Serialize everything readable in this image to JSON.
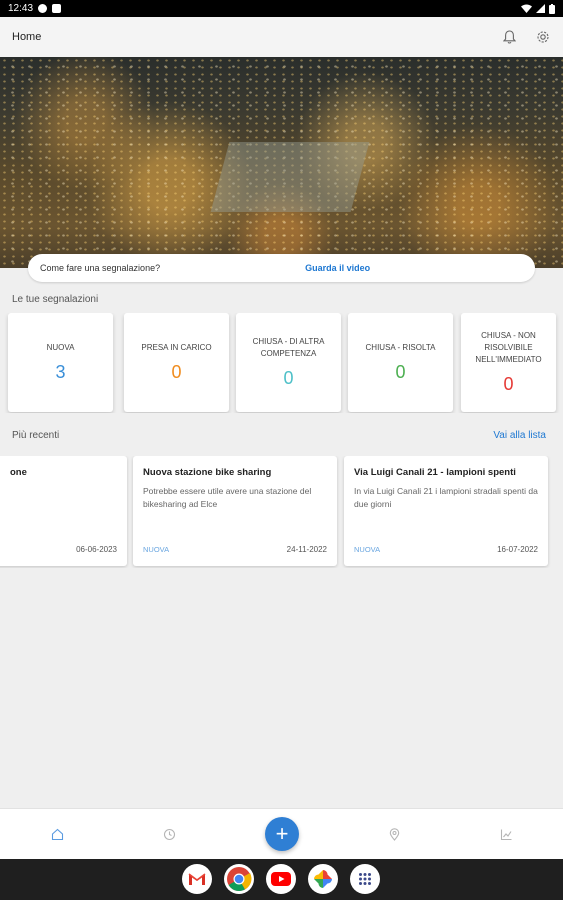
{
  "status_bar": {
    "time": "12:43"
  },
  "app_bar": {
    "title": "Home",
    "icons": [
      "bell-icon",
      "gear-icon"
    ]
  },
  "hero": {
    "image": "aerial-city-night-photo"
  },
  "video_prompt": {
    "question": "Come fare una segnalazione?",
    "link": "Guarda il video"
  },
  "stats_section": {
    "label": "Le tue segnalazioni",
    "items": [
      {
        "label": "NUOVA",
        "value": "3",
        "color": "#3a8fd8"
      },
      {
        "label": "PRESA IN CARICO",
        "value": "0",
        "color": "#f08c1e"
      },
      {
        "label": "CHIUSA - DI ALTRA COMPETENZA",
        "value": "0",
        "color": "#4ec0c8"
      },
      {
        "label": "CHIUSA - RISOLTA",
        "value": "0",
        "color": "#4caf50"
      },
      {
        "label": "CHIUSA - NON RISOLVIBILE NELL'IMMEDIATO",
        "value": "0",
        "color": "#e53935"
      }
    ]
  },
  "recent_section": {
    "label": "Più recenti",
    "link": "Vai alla lista",
    "cards": [
      {
        "title": "one",
        "description": "",
        "status": "",
        "date": "06-06-2023"
      },
      {
        "title": "Nuova stazione bike sharing",
        "description": "Potrebbe essere utile avere una stazione del bikesharing ad Elce",
        "status": "NUOVA",
        "date": "24-11-2022"
      },
      {
        "title": "Via Luigi Canali 21 - lampioni spenti",
        "description": "In via Luigi Canali 21 i lampioni stradali spenti da due giorni",
        "status": "NUOVA",
        "date": "16-07-2022"
      }
    ]
  },
  "bottom_nav": {
    "items": [
      "home-icon",
      "clock-icon",
      "add-icon",
      "map-pin-icon",
      "chart-icon"
    ],
    "fab_label": "+"
  },
  "taskbar": {
    "apps": [
      "gmail-icon",
      "chrome-icon",
      "youtube-icon",
      "photos-icon",
      "app-drawer-icon"
    ]
  },
  "colors": {
    "accent": "#2f7fd4",
    "link": "#1e78d2",
    "background": "#efefef"
  }
}
